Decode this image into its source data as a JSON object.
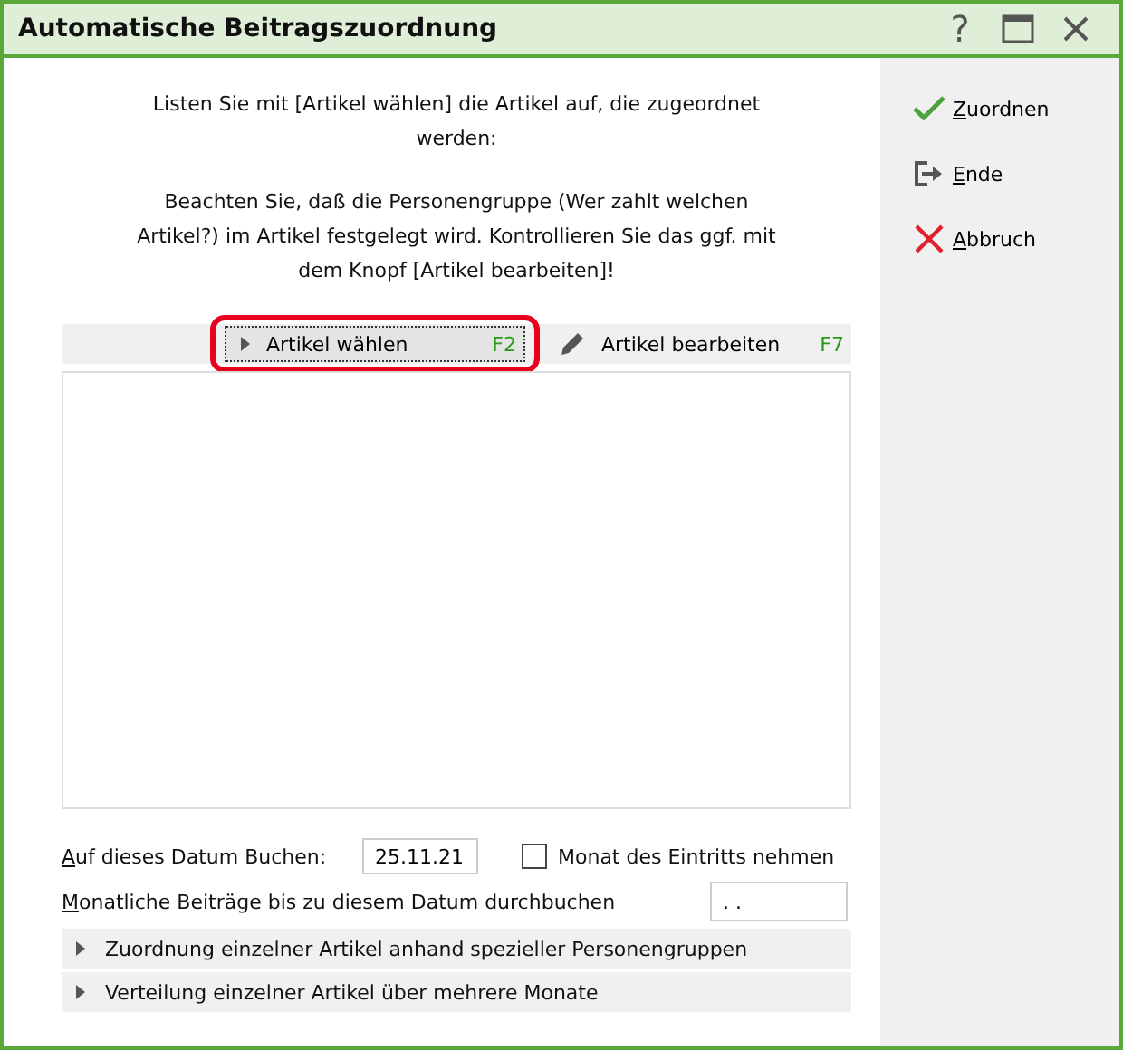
{
  "window": {
    "title": "Automatische Beitragszuordnung",
    "controls": [
      {
        "kind": "help",
        "label": "?"
      },
      {
        "kind": "maximize"
      },
      {
        "kind": "close"
      }
    ]
  },
  "instructions": [
    "Listen Sie mit [Artikel wählen] die Artikel auf, die zugeordnet werden:",
    "Beachten Sie, daß die Personengruppe (Wer zahlt welchen Artikel?) im Artikel festgelegt wird. Kontrollieren Sie das ggf. mit dem Knopf [Artikel bearbeiten]!"
  ],
  "toolbar": [
    {
      "kind": "select",
      "label": "Artikel wählen",
      "shortcut": "F2",
      "highlighted": true
    },
    {
      "kind": "edit",
      "label": "Artikel bearbeiten",
      "shortcut": "F7",
      "highlighted": false
    }
  ],
  "booking_date": {
    "label": "Auf dieses Datum Buchen:",
    "value": "25.11.21"
  },
  "entry_month": {
    "label": "Monat des Eintritts nehmen",
    "checked": false
  },
  "through_date": {
    "label": "Monatliche Beiträge bis zu diesem Datum durchbuchen",
    "value": ". ."
  },
  "sections": [
    {
      "label": "Zuordnung einzelner Artikel anhand spezieller Personengruppen",
      "expanded": false
    },
    {
      "label": "Verteilung einzelner Artikel über mehrere Monate",
      "expanded": false
    }
  ],
  "actions": [
    {
      "kind": "confirm",
      "label": "Zuordnen"
    },
    {
      "kind": "exit",
      "label": "Ende"
    },
    {
      "kind": "cancel",
      "label": "Abbruch"
    }
  ]
}
